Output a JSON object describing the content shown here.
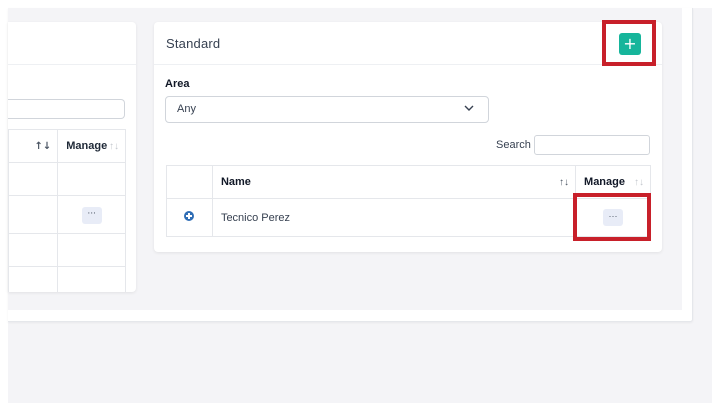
{
  "left_card": {
    "table": {
      "headers": [
        {
          "label": "",
          "sort": "↑↓"
        },
        {
          "label": "Manage",
          "sort": "↑↓"
        }
      ],
      "manage_label": "···"
    }
  },
  "standard_card": {
    "title": "Standard",
    "add_label": "+",
    "area_label": "Area",
    "area_value": "Any",
    "search_label": "Search",
    "search_value": "",
    "table": {
      "headers": {
        "name": "Name",
        "name_sort": "↑↓",
        "manage": "Manage",
        "manage_sort": "↑↓"
      },
      "rows": [
        {
          "name": "Tecnico Perez",
          "manage_label": "···"
        }
      ]
    }
  },
  "colors": {
    "accent": "#16b59b",
    "highlight": "#c8202a",
    "expand_icon": "#2f6db5"
  }
}
